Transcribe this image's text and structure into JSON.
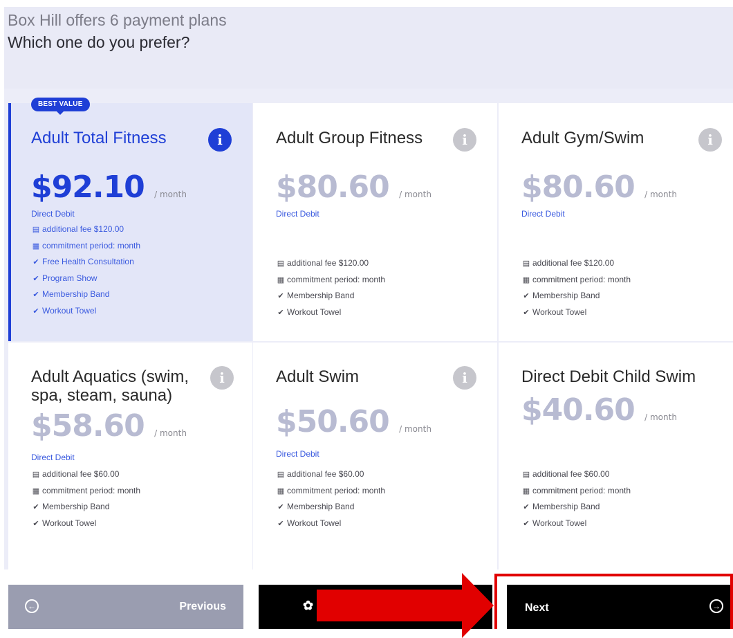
{
  "header": {
    "line1": "Box Hill offers 6 payment plans",
    "line2": "Which one do you prefer?"
  },
  "badge": "BEST VALUE",
  "plans": [
    {
      "name": "Adult Total Fitness",
      "price": "$92.10",
      "per": "/ month",
      "payment_method": "Direct Debit",
      "additional_fee": "additional fee $120.00",
      "commitment": "commitment period: month",
      "features": [
        "Free Health Consultation",
        "Program Show",
        "Membership Band",
        "Workout Towel"
      ],
      "selected": true
    },
    {
      "name": "Adult Group Fitness",
      "price": "$80.60",
      "per": "/ month",
      "payment_method": "Direct Debit",
      "additional_fee": "additional fee $120.00",
      "commitment": "commitment period: month",
      "features": [
        "Membership Band",
        "Workout Towel"
      ],
      "selected": false
    },
    {
      "name": "Adult Gym/Swim",
      "price": "$80.60",
      "per": "/ month",
      "payment_method": "Direct Debit",
      "additional_fee": "additional fee $120.00",
      "commitment": "commitment period: month",
      "features": [
        "Membership Band",
        "Workout Towel"
      ],
      "selected": false
    },
    {
      "name": "Adult Aquatics (swim, spa, steam, sauna)",
      "price": "$58.60",
      "per": "/ month",
      "payment_method": "Direct Debit",
      "additional_fee": "additional fee $60.00",
      "commitment": "commitment period: month",
      "features": [
        "Membership Band",
        "Workout Towel"
      ],
      "selected": false
    },
    {
      "name": "Adult Swim",
      "price": "$50.60",
      "per": "/ month",
      "payment_method": "Direct Debit",
      "additional_fee": "additional fee $60.00",
      "commitment": "commitment period: month",
      "features": [
        "Membership Band",
        "Workout Towel"
      ],
      "selected": false
    },
    {
      "name": "Direct Debit Child Swim",
      "price": "$40.60",
      "per": "/ month",
      "payment_method": "",
      "additional_fee": "additional fee $60.00",
      "commitment": "commitment period: month",
      "features": [
        "Membership Band",
        "Workout Towel"
      ],
      "selected": false
    }
  ],
  "info_glyph": "i",
  "icons": {
    "fee": "receipt-icon",
    "commitment": "calendar-icon",
    "feature": "checkmark-icon"
  },
  "buttons": {
    "previous": "Previous",
    "next": "Next"
  },
  "colors": {
    "accent": "#1f3fd6",
    "annotation": "#e10000",
    "header_bg": "#e9eaf6"
  }
}
